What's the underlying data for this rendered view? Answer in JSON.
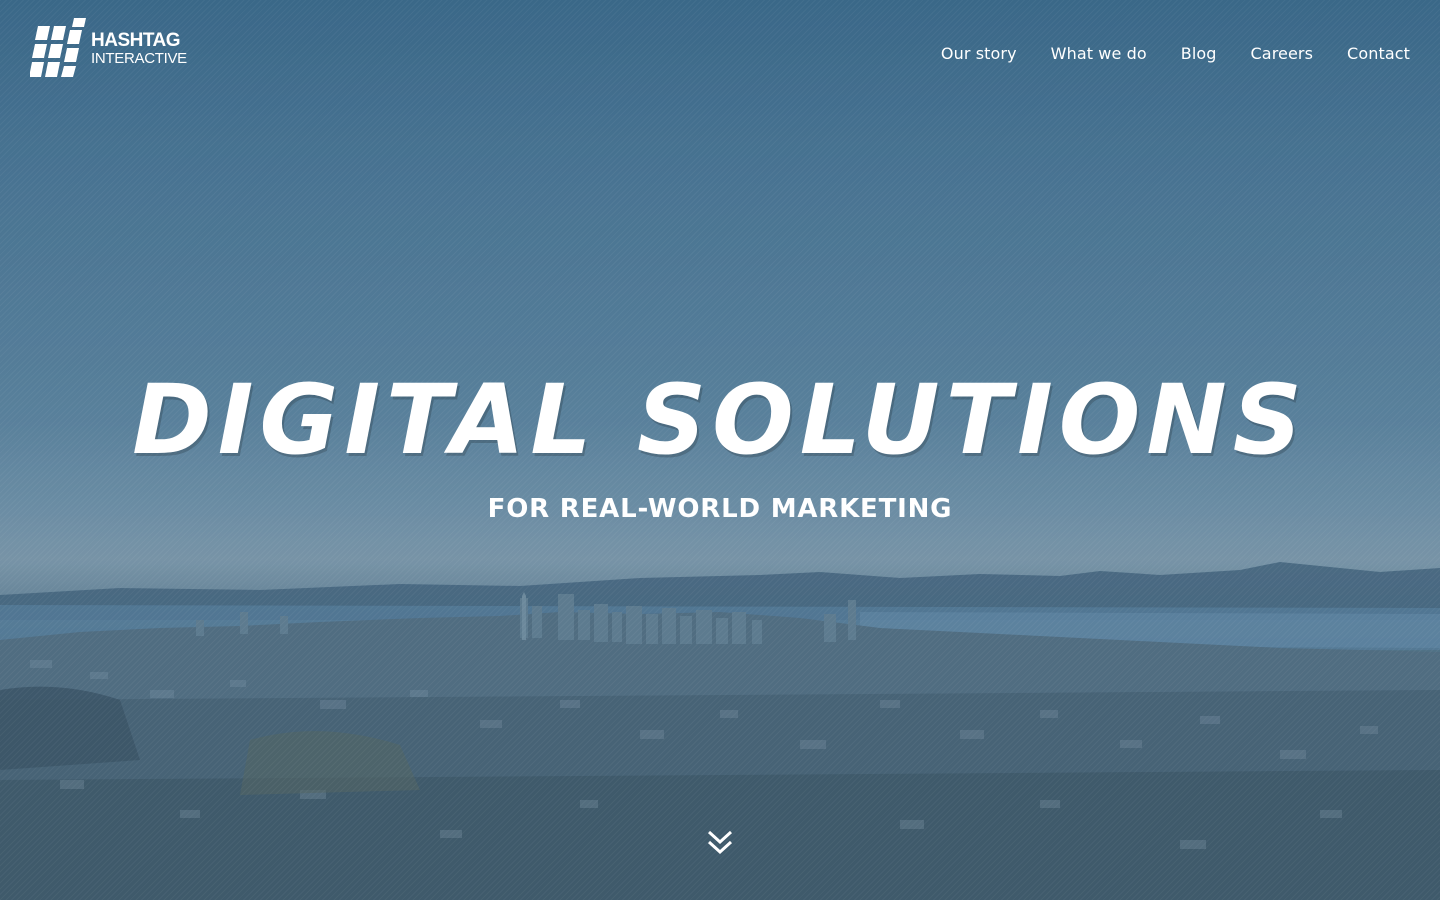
{
  "brand": {
    "name_line1": "HASHTAG",
    "name_line2": "INTERACTIVE",
    "logo_icon": "hashtag-logo-icon"
  },
  "nav": {
    "items": [
      {
        "label": "Our story"
      },
      {
        "label": "What we do"
      },
      {
        "label": "Blog"
      },
      {
        "label": "Careers"
      },
      {
        "label": "Contact"
      }
    ]
  },
  "hero": {
    "headline": "DIGITAL SOLUTIONS",
    "subheadline": "FOR REAL-WORLD MARKETING",
    "scroll_icon": "double-chevron-down-icon"
  },
  "colors": {
    "text": "#ffffff",
    "sky_top": "#3f6e8e",
    "sky_mid": "#6c92aa",
    "city_dark": "#3f5a68",
    "bay": "#5f86a3"
  }
}
